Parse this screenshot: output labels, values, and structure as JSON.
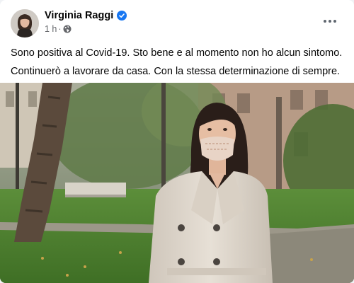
{
  "post": {
    "author": "Virginia Raggi",
    "time": "1 h",
    "separator": "·",
    "privacy_icon": "globe-icon",
    "verified_icon": "verified-badge-icon",
    "more_icon": "more-options-icon",
    "text_lines": [
      "Sono positiva al Covid-19. Sto bene e al momento non ho alcun sintomo.",
      "Continuerò a lavorare da casa. Con la stessa determinazione di sempre."
    ]
  },
  "colors": {
    "verified_blue": "#1877f2",
    "text_primary": "#050505",
    "text_secondary": "#65676b"
  }
}
